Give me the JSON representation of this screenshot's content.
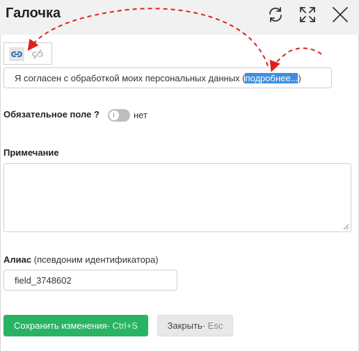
{
  "header": {
    "title": "Галочка",
    "icons": [
      "refresh-icon",
      "expand-icon",
      "close-icon"
    ]
  },
  "toolbar": {
    "icons": [
      "link-icon",
      "unlink-icon"
    ]
  },
  "label_field": {
    "text_before": "Я согласен с обработкой моих персональных данных (",
    "link_text": "подробнее...",
    "text_after": ")"
  },
  "required": {
    "label": "Обязательное поле ?",
    "toggle_state": "нет"
  },
  "note": {
    "label": "Примечание",
    "value": ""
  },
  "alias": {
    "label": "Алиас",
    "hint": "(псевдоним идентификатора)",
    "value": "field_3748602"
  },
  "buttons": {
    "save_label": "Сохранить изменения",
    "save_hint": " - Ctrl+S",
    "close_label": "Закрыть",
    "close_hint": " - Esc"
  },
  "colors": {
    "header_bg": "#f1f1f1",
    "save_green": "#28b463",
    "selection_blue": "#3d8ee0",
    "annotation_red": "#e0201b"
  }
}
